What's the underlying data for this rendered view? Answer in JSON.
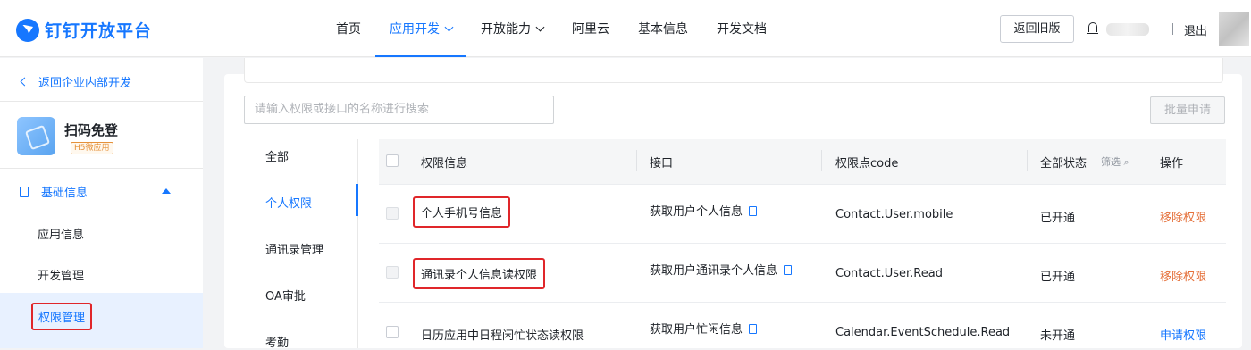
{
  "header": {
    "brand": "钉钉开放平台",
    "nav": [
      {
        "label": "首页",
        "active": false,
        "dropdown": false
      },
      {
        "label": "应用开发",
        "active": true,
        "dropdown": true
      },
      {
        "label": "开放能力",
        "active": false,
        "dropdown": true
      },
      {
        "label": "阿里云",
        "active": false,
        "dropdown": false
      },
      {
        "label": "基本信息",
        "active": false,
        "dropdown": false
      },
      {
        "label": "开发文档",
        "active": false,
        "dropdown": false
      }
    ],
    "return_old": "返回旧版",
    "logout": "退出"
  },
  "sidebar": {
    "back": "返回企业内部开发",
    "app_name": "扫码免登",
    "app_tag": "H5微应用",
    "group": "基础信息",
    "items": [
      "应用信息",
      "开发管理",
      "权限管理"
    ]
  },
  "main": {
    "search_placeholder": "请输入权限或接口的名称进行搜索",
    "batch_apply": "批量申请",
    "categories": [
      "全部",
      "个人权限",
      "通讯录管理",
      "OA审批",
      "考勤"
    ],
    "columns": [
      "权限信息",
      "接口",
      "权限点code",
      "全部状态",
      "操作"
    ],
    "filter_label": "筛选",
    "rows": [
      {
        "permission": "个人手机号信息",
        "api": "获取用户个人信息",
        "code": "Contact.User.mobile",
        "status": "已开通",
        "action": "移除权限"
      },
      {
        "permission": "通讯录个人信息读权限",
        "api": "获取用户通讯录个人信息",
        "code": "Contact.User.Read",
        "status": "已开通",
        "action": "移除权限"
      },
      {
        "permission": "日历应用中日程闲忙状态读权限",
        "api": "获取用户忙闲信息",
        "code": "Calendar.EventSchedule.Read",
        "status": "未开通",
        "action": "申请权限"
      }
    ]
  },
  "colors": {
    "primary": "#1677ff",
    "highlight": "#e0262a",
    "remove": "#e5703a"
  }
}
